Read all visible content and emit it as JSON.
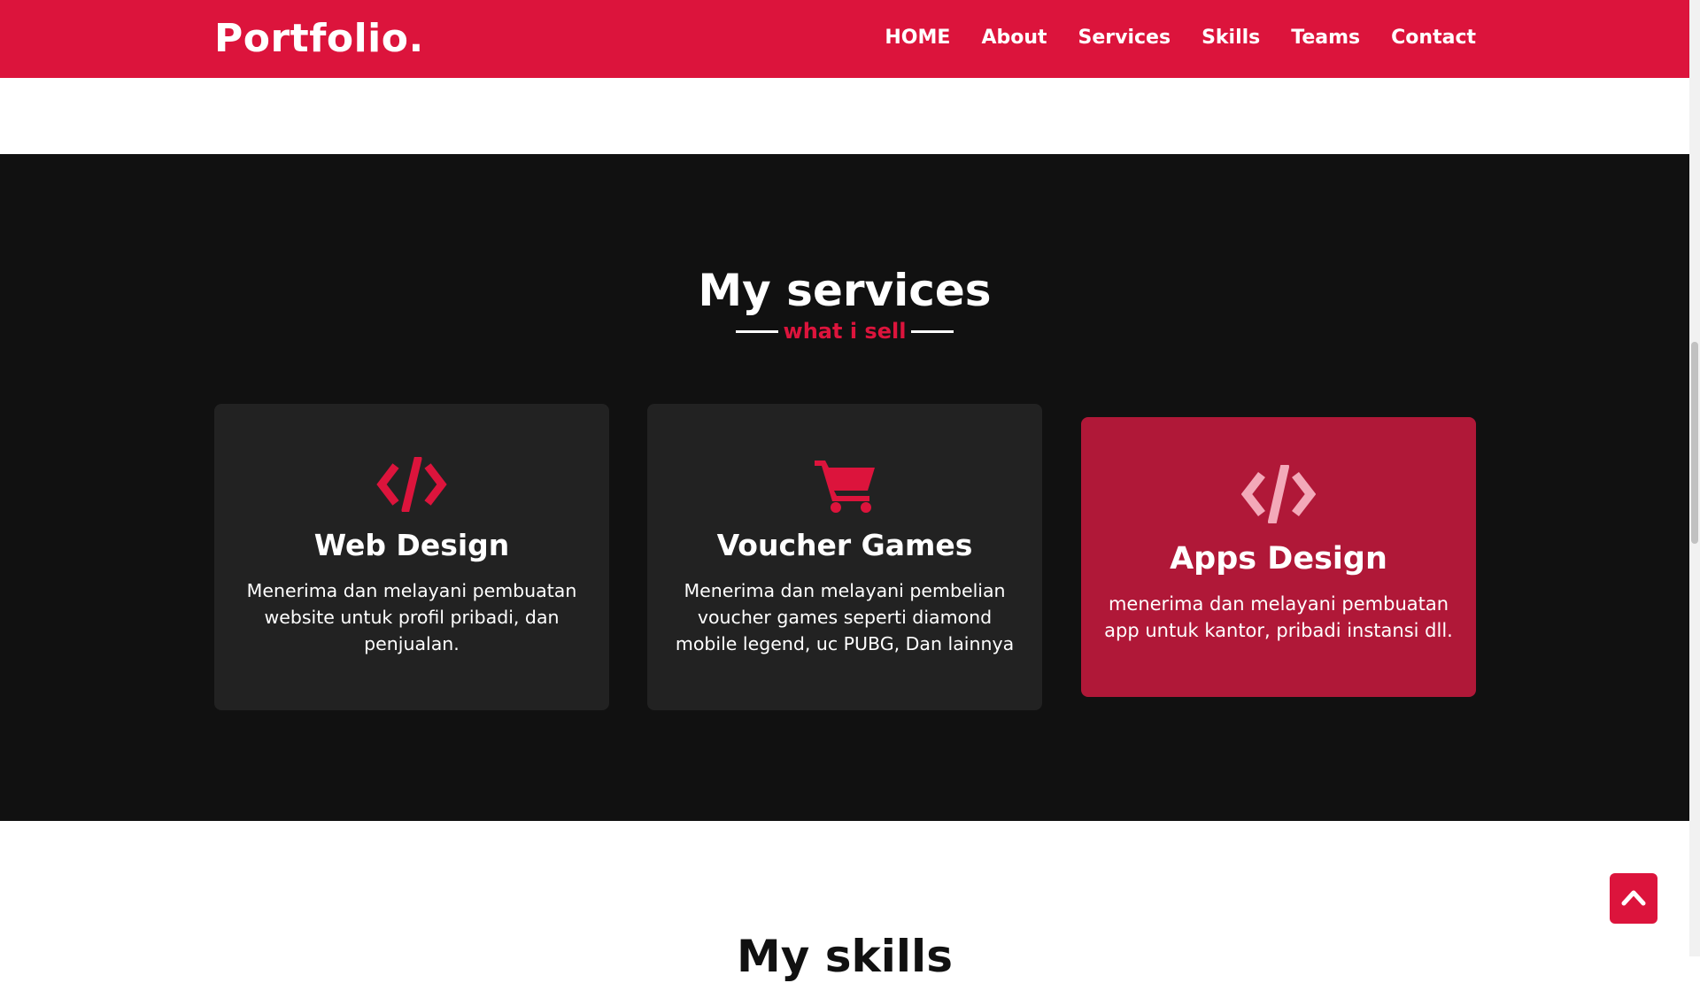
{
  "navbar": {
    "logo": "Portfolio.",
    "items": [
      {
        "label": "HOME"
      },
      {
        "label": "About"
      },
      {
        "label": "Services"
      },
      {
        "label": "Skills"
      },
      {
        "label": "Teams"
      },
      {
        "label": "Contact"
      }
    ],
    "background_color": "#dc143c"
  },
  "services": {
    "title": "My services",
    "subtitle": "what i sell",
    "cards": [
      {
        "icon": "code-icon",
        "title": "Web Design",
        "text": "Menerima dan melayani pembuatan website untuk profil pribadi, dan penjualan."
      },
      {
        "icon": "shopping-cart-icon",
        "title": "Voucher Games",
        "text": "Menerima dan melayani pembelian voucher games seperti diamond mobile legend, uc PUBG, Dan lainnya"
      },
      {
        "icon": "code-icon",
        "title": "Apps Design",
        "text": "menerima dan melayani pembuatan app untuk kantor, pribadi instansi dll."
      }
    ],
    "background_color": "#111111",
    "card_color": "#222222",
    "highlight_card_color": "#b01838",
    "accent_color": "#dc143c"
  },
  "skills": {
    "title": "My skills"
  },
  "scroll_top": {
    "icon": "chevron-up-icon"
  }
}
